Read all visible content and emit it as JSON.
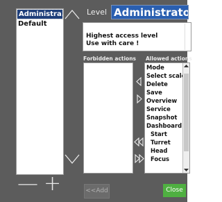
{
  "colors": {
    "panel": "#5c5c5c",
    "level_highlight": "#2a5fb0",
    "selected": "#1f3f7a",
    "close_button": "#4fb041"
  },
  "profiles": {
    "items": [
      "Administra...",
      "Default"
    ],
    "selected": "Administra..."
  },
  "controls": {
    "remove_label": "—",
    "add_label": "+"
  },
  "level": {
    "label": "Level",
    "value": "Administrator"
  },
  "description": "Highest access level\nUse with care !",
  "forbidden": {
    "label": "Forbidden actions",
    "items": []
  },
  "allowed": {
    "label": "Allowed actions",
    "items": [
      "Mode",
      "Select scale",
      "Delete",
      "Save",
      "Overview",
      "Service",
      "Snapshot",
      "Dashboard",
      "Start",
      "Turret",
      "Head",
      "Focus"
    ]
  },
  "buttons": {
    "add": "<<Add",
    "close": "Close"
  }
}
